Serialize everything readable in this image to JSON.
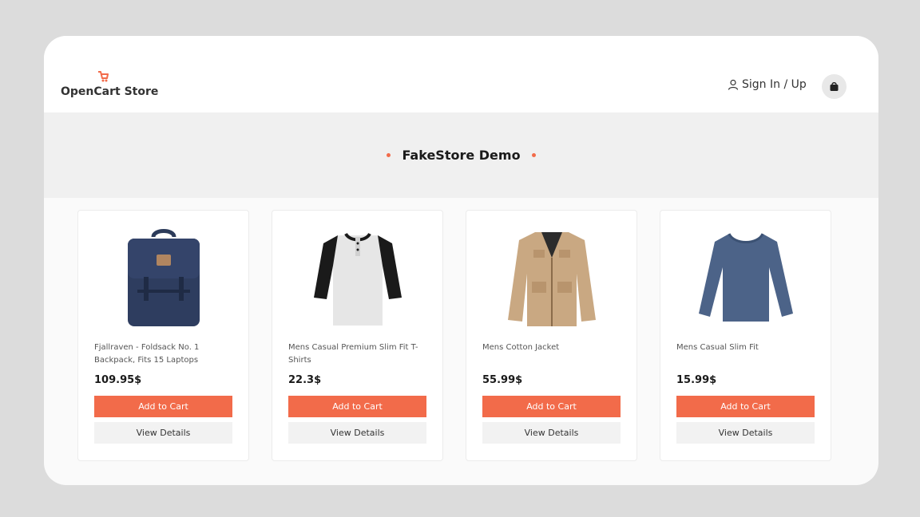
{
  "header": {
    "logo_text": "OpenCart Store",
    "signin_label": "Sign In / Up"
  },
  "banner": {
    "title": "FakeStore Demo"
  },
  "colors": {
    "accent": "#f26b4a",
    "background": "#fafafa"
  },
  "products": [
    {
      "title": "Fjallraven - Foldsack No. 1 Backpack, Fits 15 Laptops",
      "price": "109.95$",
      "add_label": "Add to Cart",
      "view_label": "View Details",
      "image_icon": "backpack-icon"
    },
    {
      "title": "Mens Casual Premium Slim Fit T-Shirts",
      "price": "22.3$",
      "add_label": "Add to Cart",
      "view_label": "View Details",
      "image_icon": "tshirt-icon"
    },
    {
      "title": "Mens Cotton Jacket",
      "price": "55.99$",
      "add_label": "Add to Cart",
      "view_label": "View Details",
      "image_icon": "jacket-icon"
    },
    {
      "title": "Mens Casual Slim Fit",
      "price": "15.99$",
      "add_label": "Add to Cart",
      "view_label": "View Details",
      "image_icon": "longsleeve-icon"
    }
  ]
}
